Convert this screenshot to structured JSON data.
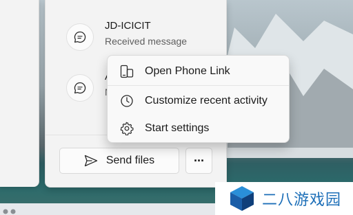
{
  "activities": [
    {
      "title": "JD-ICICIT",
      "subtitle": "Received message",
      "icon": "message-icon"
    },
    {
      "title": "A",
      "subtitle": "N",
      "icon": "message-icon"
    }
  ],
  "buttons": {
    "send_files": "Send files",
    "more": "···"
  },
  "context_menu": {
    "items": [
      {
        "label": "Open Phone Link",
        "icon": "phone-link-icon"
      },
      {
        "label": "Customize recent activity",
        "icon": "clock-icon"
      },
      {
        "label": "Start settings",
        "icon": "gear-icon"
      }
    ]
  },
  "watermark": {
    "text": "二八游戏园"
  },
  "colors": {
    "accent": "#1d6fb8",
    "panel": "#f3f3f3",
    "menu": "#f9f9f9"
  }
}
